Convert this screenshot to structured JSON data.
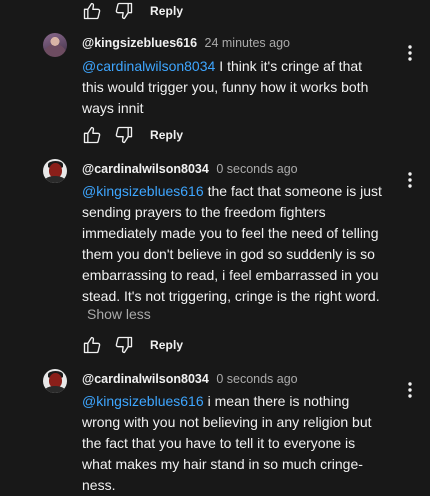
{
  "top_actions": {
    "reply_label": "Reply"
  },
  "comments": [
    {
      "handle": "@kingsizeblues616",
      "time": "24 minutes ago",
      "mention": "@cardinalwilson8034",
      "text": "I think it's cringe af that this would trigger you, funny how it works both ways innit",
      "reply_label": "Reply"
    },
    {
      "handle": "@cardinalwilson8034",
      "time": "0 seconds ago",
      "mention": "@kingsizeblues616",
      "text": "the fact that someone is just sending prayers to the freedom fighters immediately made you to feel the need of telling them you don't believe in god so suddenly is so embarrassing to read, i feel embarrassed in you stead. It's not triggering, cringe is the right word.",
      "show_less_label": "Show less",
      "reply_label": "Reply"
    },
    {
      "handle": "@cardinalwilson8034",
      "time": "0 seconds ago",
      "mention": "@kingsizeblues616",
      "text": "i mean there is nothing wrong with you not believing in any religion but the fact that you have to tell it to everyone is what makes my hair stand in so much cringe-ness."
    }
  ],
  "colors": {
    "background": "#181818",
    "text": "#f1f1f1",
    "secondary_text": "#aaaaaa",
    "mention": "#3ea6ff"
  }
}
